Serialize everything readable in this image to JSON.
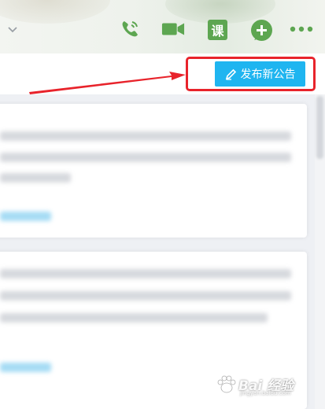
{
  "header": {
    "icons": [
      "chevron-down-icon",
      "phone-icon",
      "video-icon",
      "course-icon",
      "add-icon",
      "more-icon"
    ],
    "course_label": "课"
  },
  "toolbar": {
    "publish_label": "发布新公告",
    "publish_icon": "pencil-icon"
  },
  "annotation": {
    "box_color": "#e8232b",
    "arrow_color": "#e8232b"
  },
  "colors": {
    "accent_green": "#5da651",
    "button_blue": "#1fb5f0"
  },
  "watermark": {
    "brand": "Bai 经验",
    "sub": "jingyan.baidu.com"
  }
}
